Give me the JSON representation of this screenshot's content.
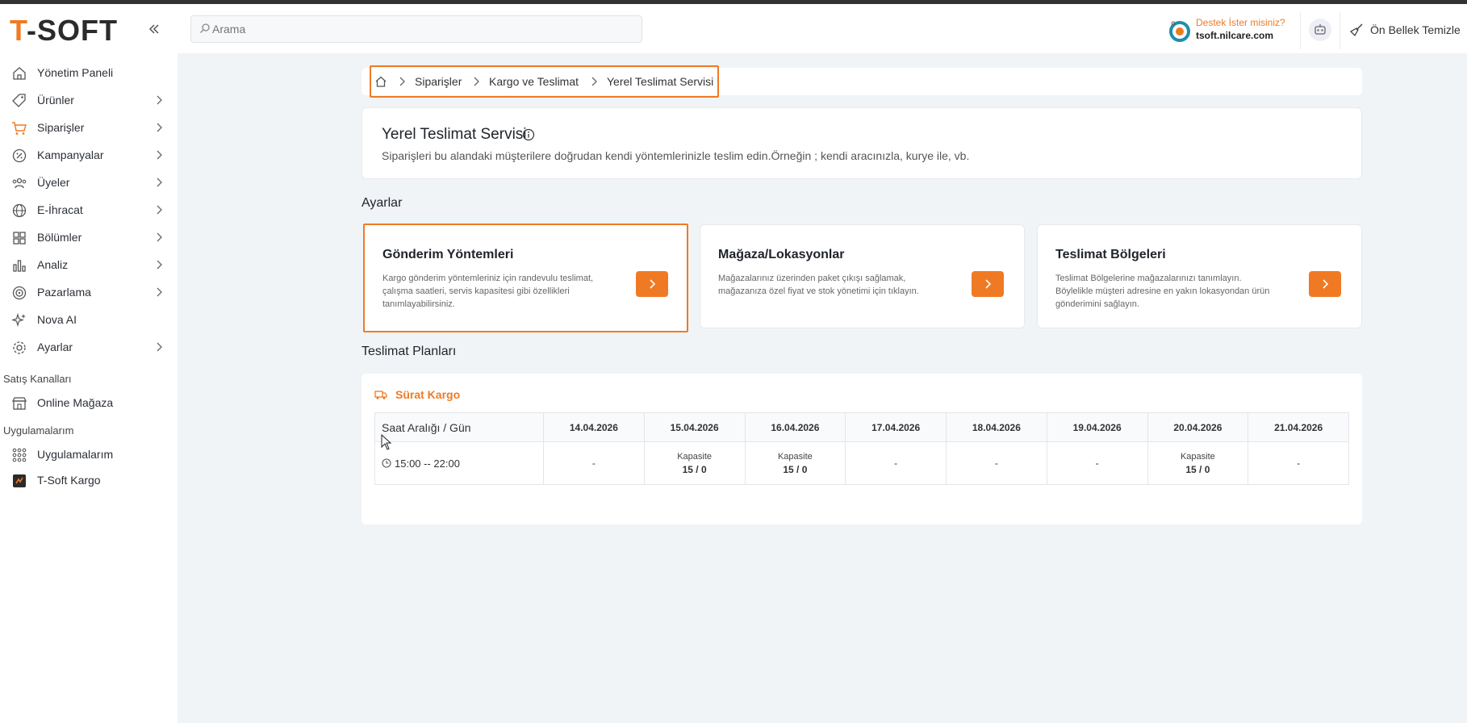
{
  "header": {
    "logo_t": "T",
    "logo_rest": "-SOFT",
    "search_placeholder": "Arama",
    "support_question": "Destek İster misiniz?",
    "support_site": "tsoft.nilcare.com",
    "cache_label": "Ön Bellek Temizle"
  },
  "sidebar": {
    "items": [
      {
        "label": "Yönetim Paneli",
        "icon": "home-icon",
        "chevron": false
      },
      {
        "label": "Ürünler",
        "icon": "tag-icon",
        "chevron": true
      },
      {
        "label": "Siparişler",
        "icon": "cart-icon",
        "chevron": true
      },
      {
        "label": "Kampanyalar",
        "icon": "discount-icon",
        "chevron": true
      },
      {
        "label": "Üyeler",
        "icon": "users-icon",
        "chevron": true
      },
      {
        "label": "E-İhracat",
        "icon": "globe-icon",
        "chevron": true
      },
      {
        "label": "Bölümler",
        "icon": "grid-icon",
        "chevron": true
      },
      {
        "label": "Analiz",
        "icon": "chart-icon",
        "chevron": true
      },
      {
        "label": "Pazarlama",
        "icon": "target-icon",
        "chevron": true
      },
      {
        "label": "Nova AI",
        "icon": "sparkle-icon",
        "chevron": false
      },
      {
        "label": "Ayarlar",
        "icon": "gear-icon",
        "chevron": true
      }
    ],
    "section_sales": "Satış Kanalları",
    "online_store": "Online Mağaza",
    "section_apps": "Uygulamalarım",
    "apps": "Uygulamalarım",
    "tsoft_kargo": "T-Soft Kargo"
  },
  "breadcrumb": {
    "items": [
      "Siparişler",
      "Kargo ve Teslimat",
      "Yerel Teslimat Servisi"
    ]
  },
  "info": {
    "title": "Yerel Teslimat Servisi",
    "description": "Siparişleri bu alandaki müşterilere doğrudan kendi yöntemlerinizle teslim edin.Örneğin ; kendi aracınızla, kurye ile, vb."
  },
  "settings": {
    "title": "Ayarlar",
    "cards": [
      {
        "title": "Gönderim Yöntemleri",
        "description": "Kargo gönderim yöntemleriniz için randevulu teslimat, çalışma saatleri, servis kapasitesi gibi özellikleri tanımlayabilirsiniz."
      },
      {
        "title": "Mağaza/Lokasyonlar",
        "description": "Mağazalarınız üzerinden paket çıkışı sağlamak, mağazanıza özel fiyat ve stok yönetimi için tıklayın."
      },
      {
        "title": "Teslimat Bölgeleri",
        "description": "Teslimat Bölgelerine mağazalarınızı tanımlayın. Böylelikle müşteri adresine en yakın lokasyondan ürün gönderimini sağlayın."
      }
    ]
  },
  "plans": {
    "title": "Teslimat Planları",
    "carrier": "Sürat Kargo",
    "header_first": "Saat Aralığı / Gün",
    "dates": [
      "14.04.2026",
      "15.04.2026",
      "16.04.2026",
      "17.04.2026",
      "18.04.2026",
      "19.04.2026",
      "20.04.2026",
      "21.04.2026"
    ],
    "slot": "15:00 -- 22:00",
    "cells": [
      {
        "label": "",
        "value": "-"
      },
      {
        "label": "Kapasite",
        "value": "15 / 0"
      },
      {
        "label": "Kapasite",
        "value": "15 / 0"
      },
      {
        "label": "",
        "value": "-"
      },
      {
        "label": "",
        "value": "-"
      },
      {
        "label": "",
        "value": "-"
      },
      {
        "label": "Kapasite",
        "value": "15 / 0"
      },
      {
        "label": "",
        "value": "-"
      }
    ]
  },
  "colors": {
    "accent": "#f07a24",
    "background": "#f1f4f6"
  }
}
